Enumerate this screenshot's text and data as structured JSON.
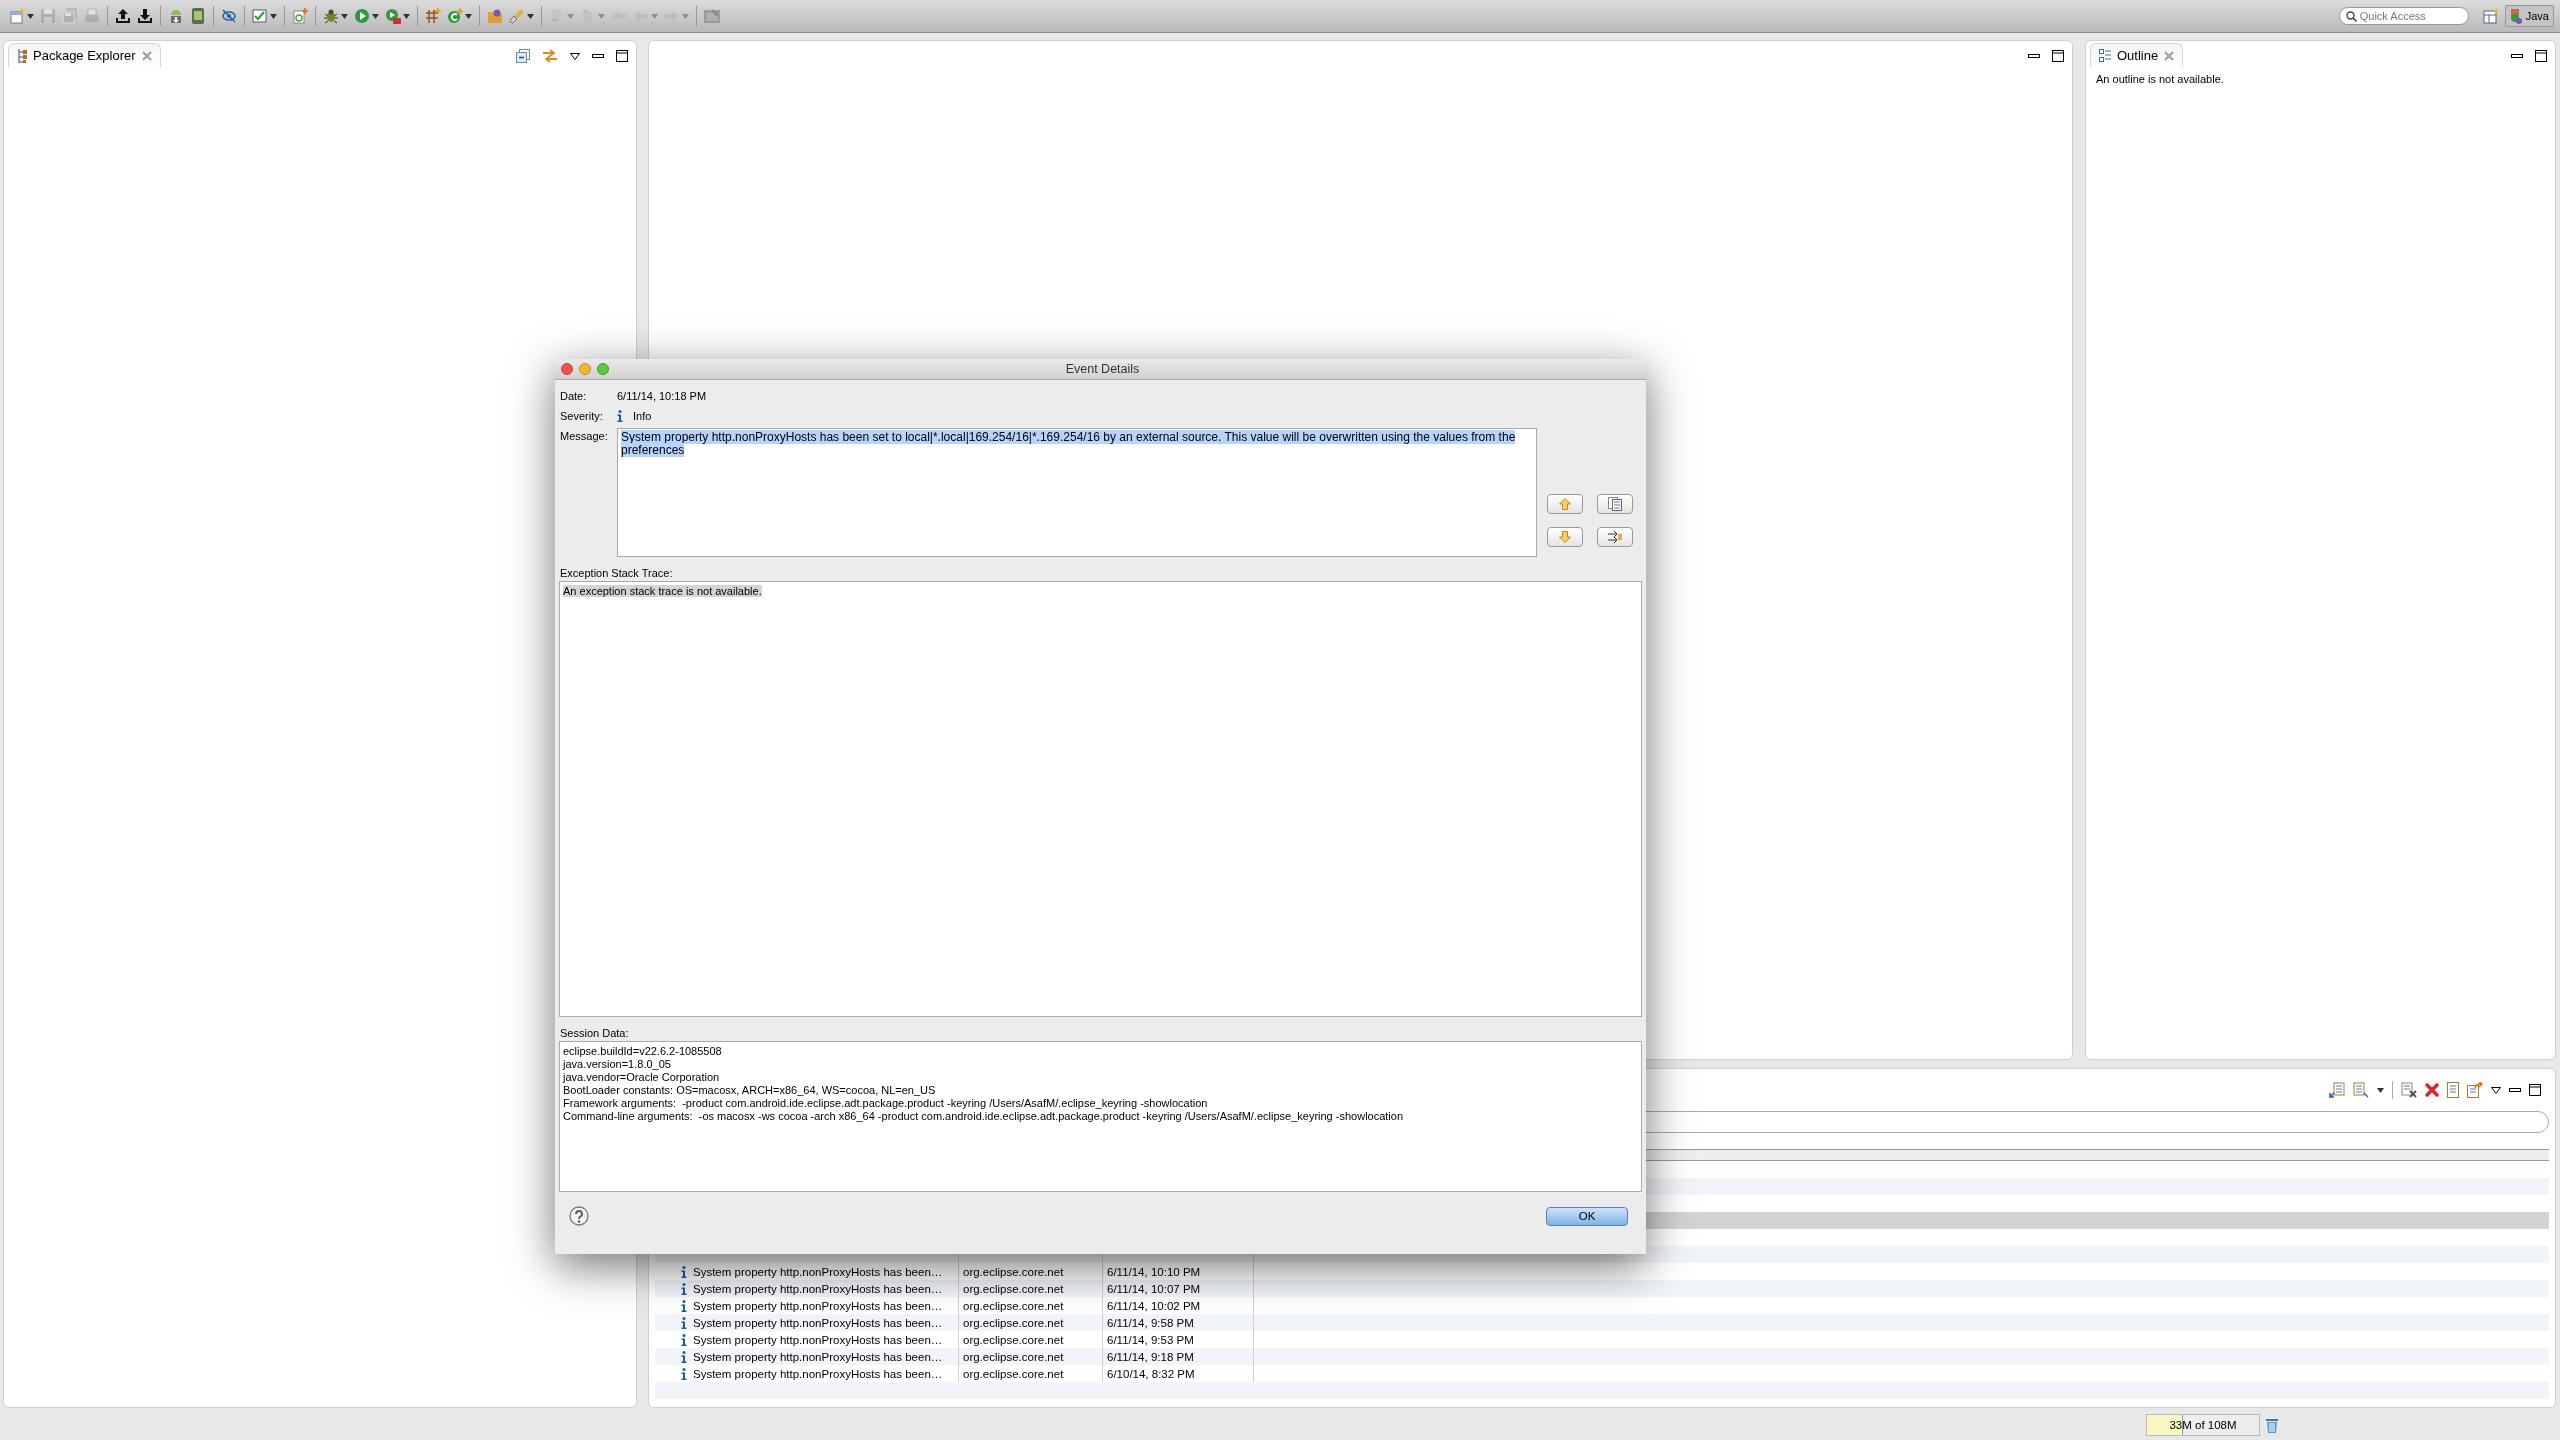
{
  "toolbar": {
    "buttons": [
      {
        "kind": "new",
        "disabled": false,
        "menu": true
      },
      {
        "kind": "save",
        "disabled": true,
        "menu": false
      },
      {
        "kind": "saveall",
        "disabled": true,
        "menu": false
      },
      {
        "kind": "print",
        "disabled": true,
        "menu": false
      },
      {
        "kind": "separator"
      },
      {
        "kind": "upload",
        "disabled": false,
        "menu": false
      },
      {
        "kind": "download",
        "disabled": false,
        "menu": false
      },
      {
        "kind": "separator"
      },
      {
        "kind": "androidsdk",
        "disabled": false,
        "menu": false
      },
      {
        "kind": "androiddevice",
        "disabled": false,
        "menu": false
      },
      {
        "kind": "separator"
      },
      {
        "kind": "eyeslash",
        "disabled": false,
        "menu": false
      },
      {
        "kind": "separator"
      },
      {
        "kind": "checkbox",
        "disabled": false,
        "menu": true
      },
      {
        "kind": "separator"
      },
      {
        "kind": "fileplus",
        "disabled": false,
        "menu": false
      },
      {
        "kind": "separator"
      },
      {
        "kind": "bug",
        "disabled": false,
        "menu": true
      },
      {
        "kind": "run",
        "disabled": false,
        "menu": true
      },
      {
        "kind": "runtools",
        "disabled": false,
        "menu": true
      },
      {
        "kind": "separator"
      },
      {
        "kind": "gridplus",
        "disabled": false,
        "menu": false
      },
      {
        "kind": "classplus",
        "disabled": false,
        "menu": true
      },
      {
        "kind": "separator"
      },
      {
        "kind": "folder",
        "disabled": false,
        "menu": false
      },
      {
        "kind": "brush",
        "disabled": false,
        "menu": true
      },
      {
        "kind": "separator"
      },
      {
        "kind": "annotnext",
        "disabled": true,
        "menu": true
      },
      {
        "kind": "annotprev",
        "disabled": true,
        "menu": true
      },
      {
        "kind": "lastedit",
        "disabled": true,
        "menu": false
      },
      {
        "kind": "back",
        "disabled": true,
        "menu": true
      },
      {
        "kind": "forward",
        "disabled": true,
        "menu": true
      },
      {
        "kind": "separator"
      },
      {
        "kind": "pin",
        "disabled": true,
        "menu": false
      }
    ],
    "quick_access": {
      "placeholder": "Quick Access"
    },
    "perspective": {
      "label": "Java",
      "selected": true
    }
  },
  "package_explorer": {
    "tab": {
      "label": "Package Explorer",
      "selected": true
    }
  },
  "outline": {
    "tab": {
      "label": "Outline",
      "selected": true
    },
    "message": "An outline is not available."
  },
  "error_log": {
    "rows": [
      {
        "selected": true
      },
      {
        "selected": false
      },
      {
        "message": "System property http.nonProxyHosts has been…",
        "plugin": "org.eclipse.core.net",
        "date": "6/11/14, 10:10 PM",
        "selected": false
      },
      {
        "message": "System property http.nonProxyHosts has been…",
        "plugin": "org.eclipse.core.net",
        "date": "6/11/14, 10:07 PM",
        "selected": false
      },
      {
        "message": "System property http.nonProxyHosts has been…",
        "plugin": "org.eclipse.core.net",
        "date": "6/11/14, 10:02 PM",
        "selected": false
      },
      {
        "message": "System property http.nonProxyHosts has been…",
        "plugin": "org.eclipse.core.net",
        "date": "6/11/14, 9:58 PM",
        "selected": false
      },
      {
        "message": "System property http.nonProxyHosts has been…",
        "plugin": "org.eclipse.core.net",
        "date": "6/11/14, 9:53 PM",
        "selected": false
      },
      {
        "message": "System property http.nonProxyHosts has been…",
        "plugin": "org.eclipse.core.net",
        "date": "6/11/14, 9:18 PM",
        "selected": false
      },
      {
        "message": "System property http.nonProxyHosts has been…",
        "plugin": "org.eclipse.core.net",
        "date": "6/10/14, 8:32 PM",
        "selected": false
      }
    ]
  },
  "dialog": {
    "title": "Event Details",
    "date_label": "Date:",
    "date": "6/11/14, 10:18 PM",
    "severity_label": "Severity:",
    "severity": "Info",
    "message_label": "Message:",
    "message": {
      "text": "System property http.nonProxyHosts has been set to local|*.local|169.254/16|*.169.254/16 by an external source. This value will be overwritten using the values from the preferences",
      "highlighted": true
    },
    "stack_label": "Exception Stack Trace:",
    "stack_trace": {
      "text": "An exception stack trace is not available.",
      "highlighted": true
    },
    "session_label": "Session Data:",
    "session_lines": [
      "eclipse.buildId=v22.6.2-1085508",
      "java.version=1.8.0_05",
      "java.vendor=Oracle Corporation",
      "BootLoader constants: OS=macosx, ARCH=x86_64, WS=cocoa, NL=en_US",
      "Framework arguments:  -product com.android.ide.eclipse.adt.package.product -keyring /Users/AsafM/.eclipse_keyring -showlocation",
      "Command-line arguments:  -os macosx -ws cocoa -arch x86_64 -product com.android.ide.eclipse.adt.package.product -keyring /Users/AsafM/.eclipse_keyring -showlocation"
    ],
    "ok": "OK"
  },
  "status_bar": {
    "memory": "33M of 108M",
    "level": 0.31
  }
}
